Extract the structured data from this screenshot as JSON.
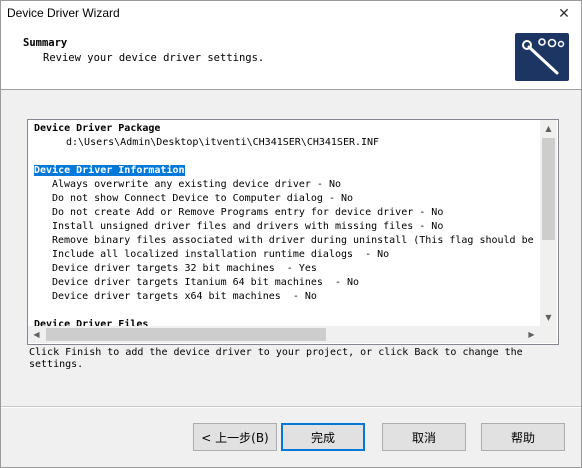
{
  "window": {
    "title": "Device Driver Wizard",
    "close_glyph": "✕"
  },
  "header": {
    "title": "Summary",
    "subtitle": "Review your device driver settings.",
    "logo_icon": "wizard-wand-icon"
  },
  "summary": {
    "lines": [
      {
        "text": "Device Driver Package",
        "bold": true,
        "indent": 0
      },
      {
        "text": "d:\\Users\\Admin\\Desktop\\itventi\\CH341SER\\CH341SER.INF",
        "bold": false,
        "indent": 1
      },
      {
        "text": "",
        "bold": false,
        "indent": 0
      },
      {
        "text": "Device Driver Information",
        "bold": true,
        "indent": 0,
        "selected": true
      },
      {
        "text": "Always overwrite any existing device driver - No",
        "bold": false,
        "indent": 2
      },
      {
        "text": "Do not show Connect Device to Computer dialog - No",
        "bold": false,
        "indent": 2
      },
      {
        "text": "Do not create Add or Remove Programs entry for device driver - No",
        "bold": false,
        "indent": 2
      },
      {
        "text": "Install unsigned driver files and drivers with missing files - No",
        "bold": false,
        "indent": 2
      },
      {
        "text": "Remove binary files associated with driver during uninstall (This flag should be s",
        "bold": false,
        "indent": 2
      },
      {
        "text": "Include all localized installation runtime dialogs  - No",
        "bold": false,
        "indent": 2
      },
      {
        "text": "Device driver targets 32 bit machines  - Yes",
        "bold": false,
        "indent": 2
      },
      {
        "text": "Device driver targets Itanium 64 bit machines  - No",
        "bold": false,
        "indent": 2
      },
      {
        "text": "Device driver targets x64 bit machines  - No",
        "bold": false,
        "indent": 2
      },
      {
        "text": "",
        "bold": false,
        "indent": 0
      },
      {
        "text": "Device Driver Files",
        "bold": true,
        "indent": 0
      }
    ]
  },
  "footer": {
    "instruction": "Click Finish to add the device driver to your project, or click Back to change the settings."
  },
  "buttons": {
    "back": "< 上一步(B)",
    "finish": "完成",
    "cancel": "取消",
    "help": "帮助"
  },
  "colors": {
    "selection": "#0078d7",
    "logo_bg": "#1c3563",
    "default_button_border": "#0078d7"
  }
}
